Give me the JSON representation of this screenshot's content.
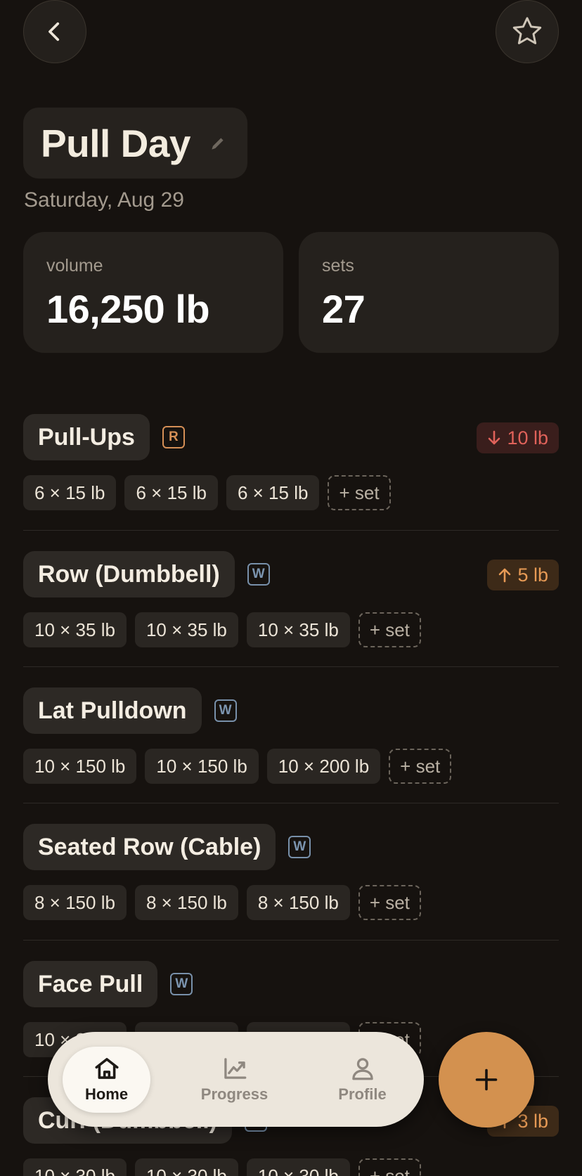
{
  "header": {
    "title": "Pull Day",
    "date": "Saturday, Aug 29"
  },
  "stats": {
    "volume": {
      "label": "volume",
      "value": "16,250 lb"
    },
    "sets": {
      "label": "sets",
      "value": "27"
    }
  },
  "exercises": [
    {
      "name": "Pull-Ups",
      "badge": "R",
      "change": "10 lb",
      "change_dir": "down",
      "sets": [
        "6 × 15 lb",
        "6 × 15 lb",
        "6 × 15 lb"
      ],
      "add_label": "+ set"
    },
    {
      "name": "Row (Dumbbell)",
      "badge": "W",
      "change": "5 lb",
      "change_dir": "up",
      "sets": [
        "10 × 35 lb",
        "10 × 35 lb",
        "10 × 35 lb"
      ],
      "add_label": "+ set"
    },
    {
      "name": "Lat Pulldown",
      "badge": "W",
      "change": "",
      "change_dir": "",
      "sets": [
        "10 × 150 lb",
        "10 × 150 lb",
        "10 × 200 lb"
      ],
      "add_label": "+ set"
    },
    {
      "name": "Seated Row (Cable)",
      "badge": "W",
      "change": "",
      "change_dir": "",
      "sets": [
        "8 × 150 lb",
        "8 × 150 lb",
        "8 × 150 lb"
      ],
      "add_label": "+ set"
    },
    {
      "name": "Face Pull",
      "badge": "W",
      "change": "",
      "change_dir": "",
      "sets": [
        "10 × 30 lb",
        "10 × 30 lb",
        "10 × 30 lb"
      ],
      "add_label": "+ set"
    },
    {
      "name": "Curl (Dumbbell)",
      "badge": "W",
      "change": "3 lb",
      "change_dir": "up",
      "sets": [
        "10 × 30 lb",
        "10 × 30 lb",
        "10 × 30 lb"
      ],
      "add_label": "+ set"
    }
  ],
  "nav": {
    "items": [
      {
        "label": "Home",
        "icon": "home-icon",
        "active": true
      },
      {
        "label": "Progress",
        "icon": "chart-icon",
        "active": false
      },
      {
        "label": "Profile",
        "icon": "person-icon",
        "active": false
      }
    ],
    "fab_icon": "plus-icon"
  },
  "colors": {
    "background": "#16120f",
    "card": "#25211d",
    "accent": "#d3914f",
    "down": "#e0625a",
    "up": "#e79a55",
    "nav_bg": "#ece6dc"
  }
}
